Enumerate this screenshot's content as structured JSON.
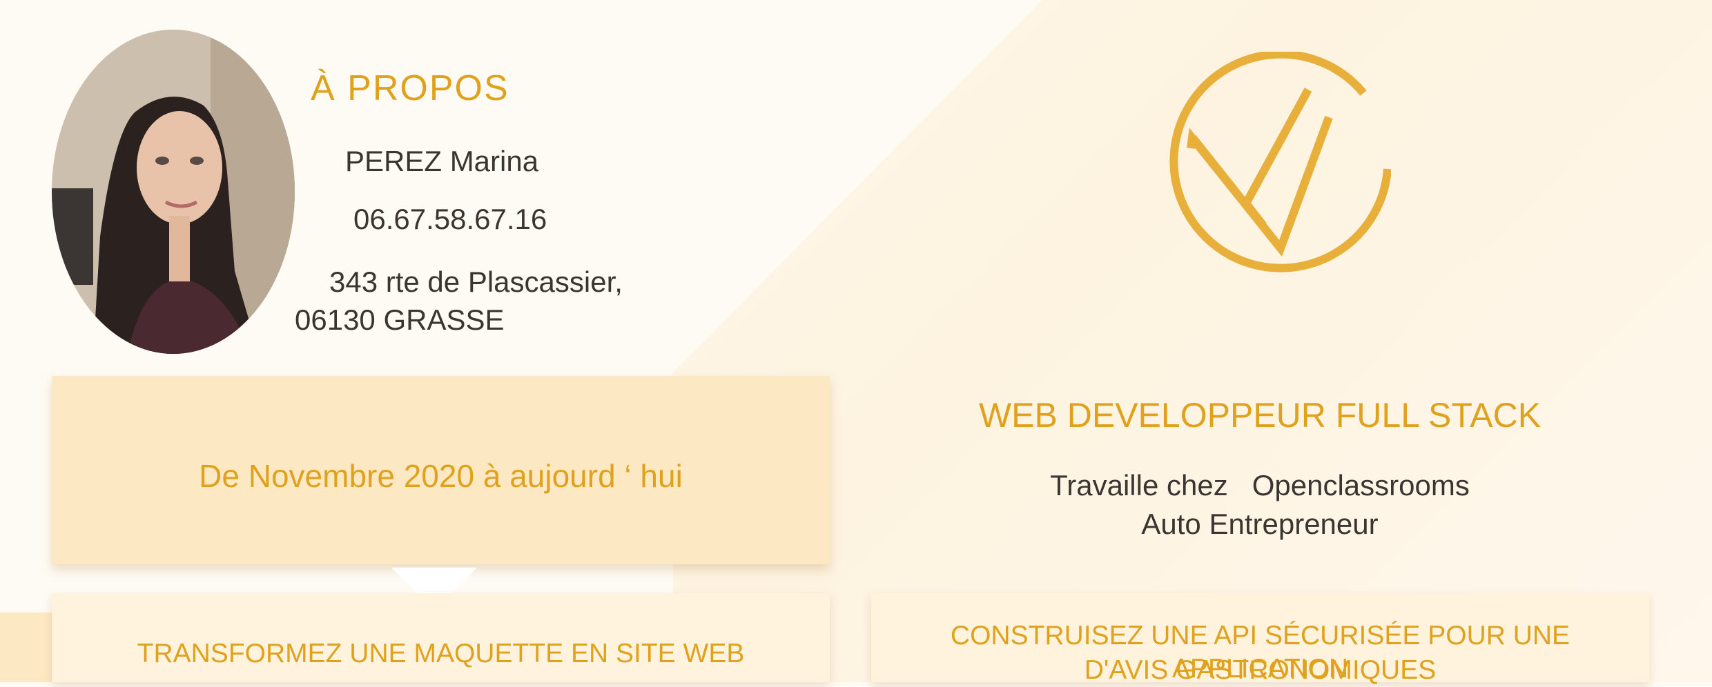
{
  "about": {
    "title": "À PROPOS",
    "name": "PEREZ Marina",
    "phone": "06.67.58.67.16",
    "address_line1": "343 rte de Plascassier,",
    "address_line2": "06130 GRASSE"
  },
  "logo_icon": "vc-monogram-logo",
  "job": {
    "title": "WEB DEVELOPPEUR FULL STACK",
    "line1": "Travaille chez   Openclassrooms",
    "line2": "Auto Entrepreneur"
  },
  "period": {
    "text": "De Novembre 2020 à aujourd ‘ hui"
  },
  "projects": [
    {
      "text": "TRANSFORMEZ UNE MAQUETTE EN SITE WEB"
    },
    {
      "line1": "CONSTRUISEZ UNE API SÉCURISÉE POUR UNE APPLICATION",
      "line2": "D'AVIS GASTRONOMIQUES"
    }
  ],
  "colors": {
    "accent": "#e0a21d",
    "text": "#3c3430",
    "box": "#fde8c4",
    "card": "#fff3dd",
    "background": "#fefbf4"
  }
}
